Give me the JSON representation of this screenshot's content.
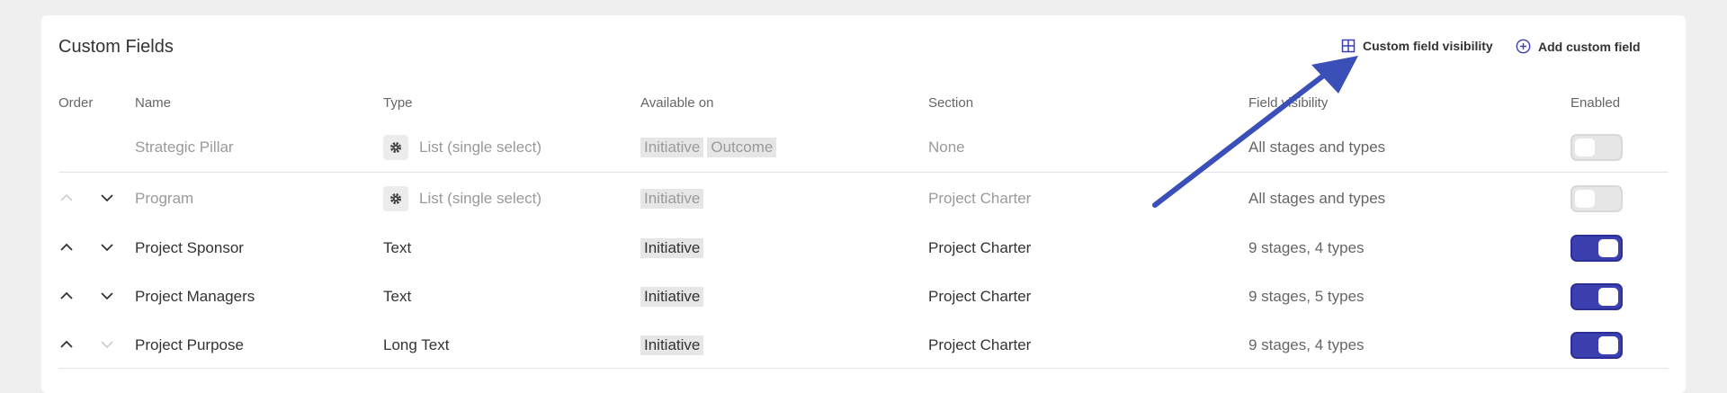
{
  "header": {
    "title": "Custom Fields",
    "visibility_label": "Custom field visibility",
    "add_label": "Add custom field"
  },
  "columns": {
    "order": "Order",
    "name": "Name",
    "type": "Type",
    "available": "Available on",
    "section": "Section",
    "visibility": "Field visibility",
    "enabled": "Enabled"
  },
  "rows": [
    {
      "name": "Strategic Pillar",
      "type": "List (single select)",
      "available": [
        "Initiative",
        "Outcome"
      ],
      "section": "None",
      "visibility": "All stages and types",
      "enabled": false
    },
    {
      "name": "Program",
      "type": "List (single select)",
      "available": [
        "Initiative"
      ],
      "section": "Project Charter",
      "visibility": "All stages and types",
      "enabled": false
    },
    {
      "name": "Project Sponsor",
      "type": "Text",
      "available": [
        "Initiative"
      ],
      "section": "Project Charter",
      "visibility": "9 stages, 4 types",
      "enabled": true
    },
    {
      "name": "Project Managers",
      "type": "Text",
      "available": [
        "Initiative"
      ],
      "section": "Project Charter",
      "visibility": "9 stages, 5 types",
      "enabled": true
    },
    {
      "name": "Project Purpose",
      "type": "Long Text",
      "available": [
        "Initiative"
      ],
      "section": "Project Charter",
      "visibility": "9 stages, 4 types",
      "enabled": true
    }
  ],
  "colors": {
    "accent": "#3b3fb0",
    "annotation_arrow": "#3a4fb8"
  }
}
